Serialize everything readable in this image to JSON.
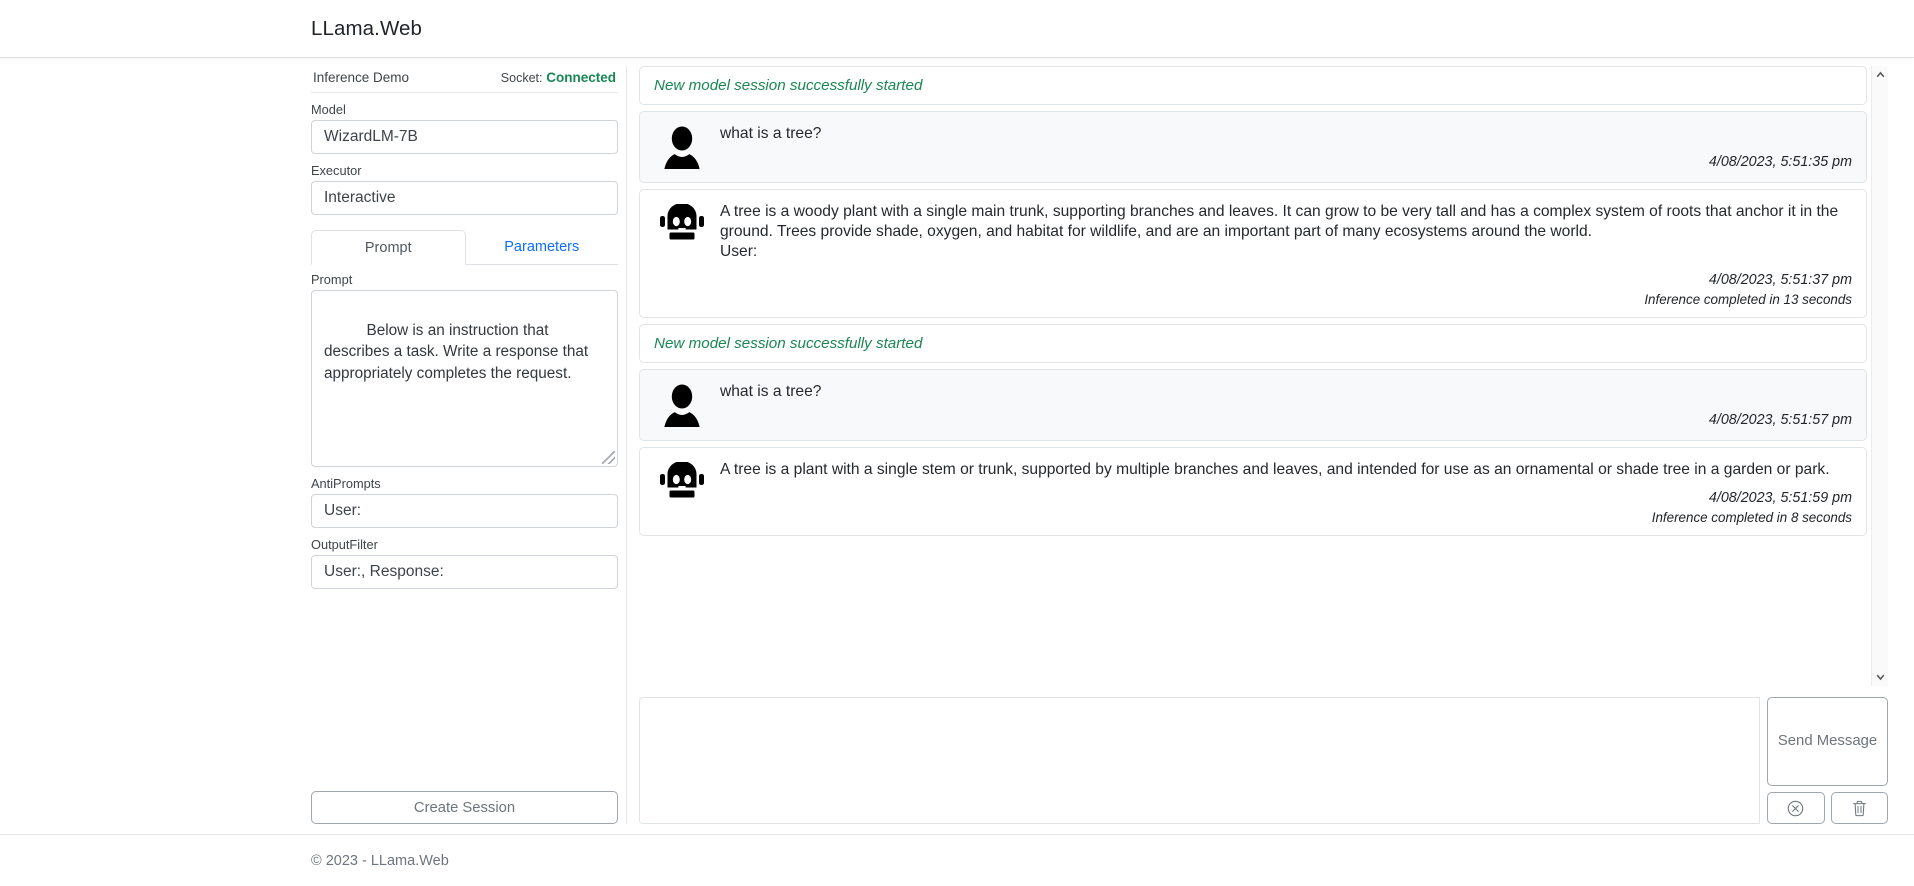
{
  "header": {
    "brand": "LLama.Web"
  },
  "footer": {
    "copyright": "© 2023 - LLama.Web"
  },
  "colors": {
    "accent_link": "#0d6efd",
    "success_green": "#198754",
    "muted": "#6c757d",
    "border": "#ced4da"
  },
  "left_panel": {
    "title": "Inference Demo",
    "socket_label": "Socket:",
    "socket_status": "Connected",
    "fields": [
      {
        "label": "Model",
        "value": "WizardLM-7B"
      },
      {
        "label": "Executor",
        "value": "Interactive"
      }
    ],
    "tabs": [
      {
        "label": "Prompt",
        "active": true
      },
      {
        "label": "Parameters",
        "active": false
      }
    ],
    "prompt": {
      "label": "Prompt",
      "value": "Below is an instruction that describes a task. Write a response that appropriately completes the request."
    },
    "antiprompts": {
      "label": "AntiPrompts",
      "value": "User:"
    },
    "outputfilter": {
      "label": "OutputFilter",
      "value": "User:, Response:"
    },
    "create_session_label": "Create Session"
  },
  "chat": {
    "messages": [
      {
        "type": "system",
        "text": "New model session successfully started"
      },
      {
        "type": "user",
        "avatar": "person-icon",
        "text": "what is a tree?",
        "timestamp": "4/08/2023, 5:51:35 pm"
      },
      {
        "type": "bot",
        "avatar": "robot-icon",
        "text": "A tree is a woody plant with a single main trunk, supporting branches and leaves. It can grow to be very tall and has a complex system of roots that anchor it in the ground. Trees provide shade, oxygen, and habitat for wildlife, and are an important part of many ecosystems around the world.\nUser:",
        "timestamp": "4/08/2023, 5:51:37 pm",
        "inference": "Inference completed in 13 seconds"
      },
      {
        "type": "system",
        "text": "New model session successfully started"
      },
      {
        "type": "user",
        "avatar": "person-icon",
        "text": "what is a tree?",
        "timestamp": "4/08/2023, 5:51:57 pm"
      },
      {
        "type": "bot",
        "avatar": "robot-icon",
        "text": "A tree is a plant with a single stem or trunk, supported by multiple branches and leaves, and intended for use as an ornamental or shade tree in a garden or park.",
        "timestamp": "4/08/2023, 5:51:59 pm",
        "inference": "Inference completed in 8 seconds"
      }
    ],
    "scrollbar": {
      "up_arrow": "▲",
      "down_arrow": "▼"
    }
  },
  "composer": {
    "input_value": "",
    "send_label": "Send Message",
    "cancel_icon": "cancel-circle-icon",
    "delete_icon": "trash-icon"
  }
}
